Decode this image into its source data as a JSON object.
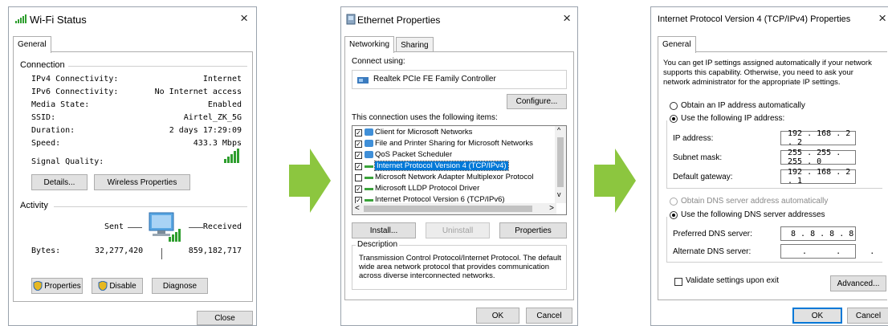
{
  "colors": {
    "accent": "#0078d7",
    "arrow": "#8cc63f",
    "selection": "#0078d7"
  },
  "wifi": {
    "title": "Wi-Fi Status",
    "close": "×",
    "tab": "General",
    "connection_header": "Connection",
    "rows": [
      {
        "label": "IPv4 Connectivity:",
        "value": "Internet"
      },
      {
        "label": "IPv6 Connectivity:",
        "value": "No Internet access"
      },
      {
        "label": "Media State:",
        "value": "Enabled"
      },
      {
        "label": "SSID:",
        "value": "Airtel_ZK_5G"
      },
      {
        "label": "Duration:",
        "value": "2 days 17:29:09"
      },
      {
        "label": "Speed:",
        "value": "433.3 Mbps"
      }
    ],
    "signal_label": "Signal Quality:",
    "details_btn": "Details...",
    "wireless_btn": "Wireless Properties",
    "activity_header": "Activity",
    "sent": "Sent",
    "received": "Received",
    "bytes_label": "Bytes:",
    "bytes_sent": "32,277,420",
    "bytes_received": "859,182,717",
    "properties_btn": "Properties",
    "disable_btn": "Disable",
    "diagnose_btn": "Diagnose",
    "close_btn": "Close"
  },
  "eth": {
    "title": "Ethernet Properties",
    "close": "×",
    "tabs": [
      "Networking",
      "Sharing"
    ],
    "connect_using": "Connect using:",
    "adapter": "Realtek PCIe FE Family Controller",
    "configure_btn": "Configure...",
    "items_label": "This connection uses the following items:",
    "items": [
      {
        "label": "Client for Microsoft Networks",
        "checked": true
      },
      {
        "label": "File and Printer Sharing for Microsoft Networks",
        "checked": true
      },
      {
        "label": "QoS Packet Scheduler",
        "checked": true
      },
      {
        "label": "Internet Protocol Version 4 (TCP/IPv4)",
        "checked": true,
        "selected": true
      },
      {
        "label": "Microsoft Network Adapter Multiplexor Protocol",
        "checked": false
      },
      {
        "label": "Microsoft LLDP Protocol Driver",
        "checked": true
      },
      {
        "label": "Internet Protocol Version 6 (TCP/IPv6)",
        "checked": true
      }
    ],
    "install_btn": "Install...",
    "uninstall_btn": "Uninstall",
    "properties_btn": "Properties",
    "description_label": "Description",
    "description_text": "Transmission Control Protocol/Internet Protocol. The default wide area network protocol that provides communication across diverse interconnected networks.",
    "ok_btn": "OK",
    "cancel_btn": "Cancel"
  },
  "ipv4": {
    "title": "Internet Protocol Version 4 (TCP/IPv4) Properties",
    "close": "×",
    "tab": "General",
    "intro": "You can get IP settings assigned automatically if your network supports this capability. Otherwise, you need to ask your network administrator for the appropriate IP settings.",
    "obtain_ip_auto": "Obtain an IP address automatically",
    "use_following_ip": "Use the following IP address:",
    "ip_label": "IP address:",
    "ip_value": "192 . 168 .  2  .  2",
    "subnet_label": "Subnet mask:",
    "subnet_value": "255 . 255 . 255 .  0",
    "gateway_label": "Default gateway:",
    "gateway_value": "192 . 168 .  2  .  1",
    "obtain_dns_auto": "Obtain DNS server address automatically",
    "use_following_dns": "Use the following DNS server addresses",
    "pref_dns_label": "Preferred DNS server:",
    "pref_dns_value": "8  .  8  .  8  .  8",
    "alt_dns_label": "Alternate DNS server:",
    "alt_dns_value": " .      .      .",
    "validate": "Validate settings upon exit",
    "advanced_btn": "Advanced...",
    "ok_btn": "OK",
    "cancel_btn": "Cancel"
  }
}
